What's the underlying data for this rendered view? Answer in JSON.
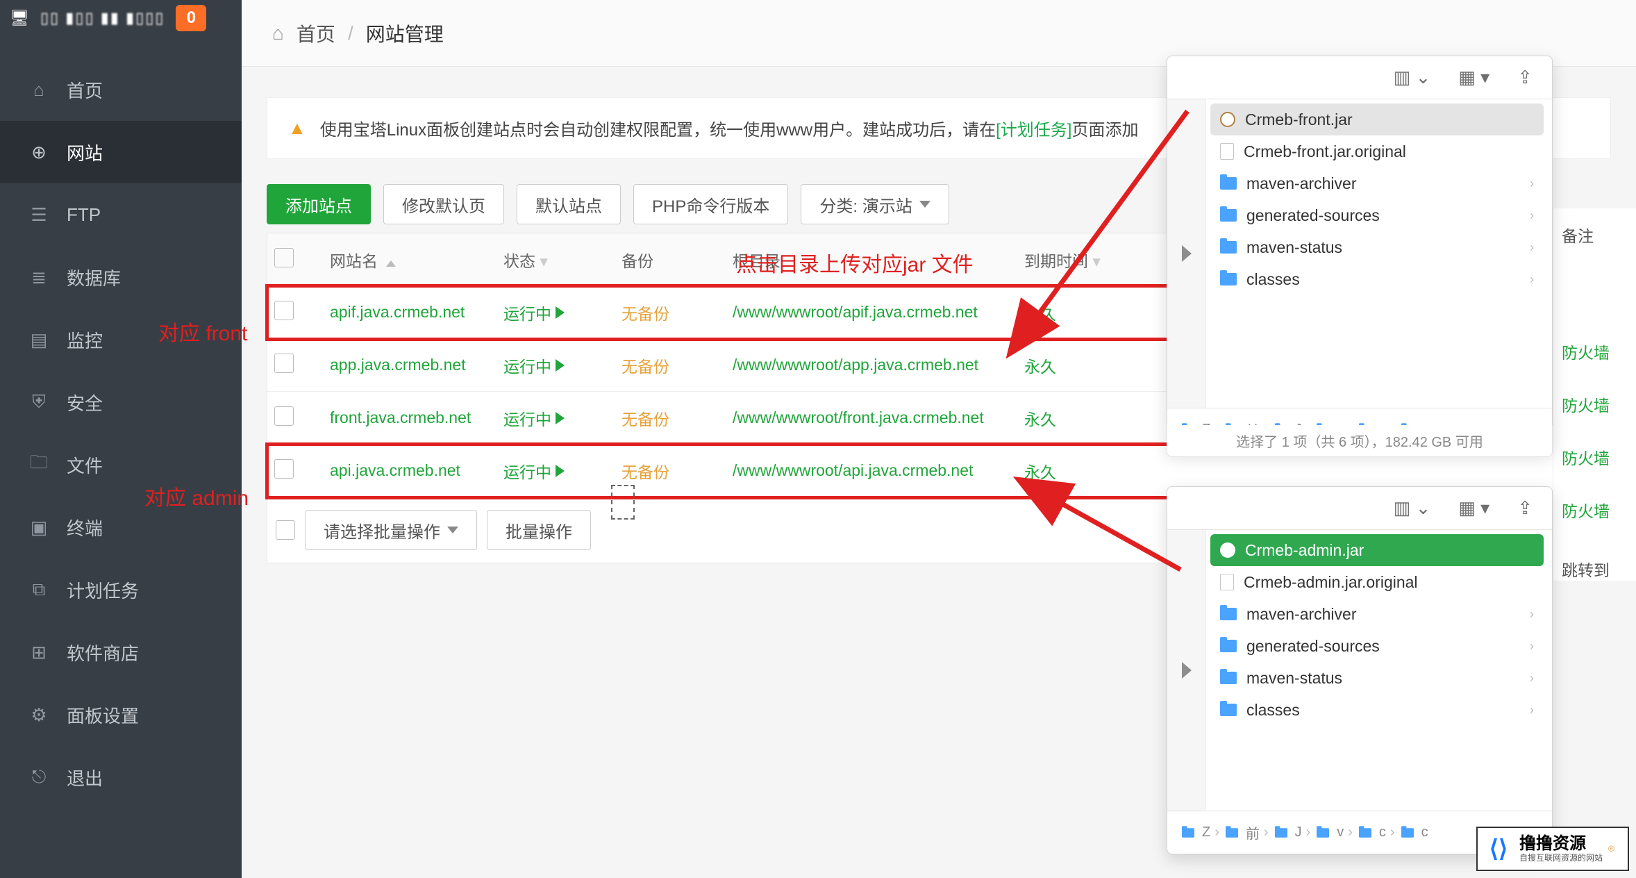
{
  "sidebar": {
    "badge": "0",
    "masked": "▯▯ ▮▯▯ ▮▮ ▮▯▯▯",
    "items": [
      {
        "label": "首页",
        "icon": "home"
      },
      {
        "label": "网站",
        "icon": "globe"
      },
      {
        "label": "FTP",
        "icon": "ftp"
      },
      {
        "label": "数据库",
        "icon": "database"
      },
      {
        "label": "监控",
        "icon": "monitor"
      },
      {
        "label": "安全",
        "icon": "shield"
      },
      {
        "label": "文件",
        "icon": "folder"
      },
      {
        "label": "终端",
        "icon": "terminal"
      },
      {
        "label": "计划任务",
        "icon": "schedule"
      },
      {
        "label": "软件商店",
        "icon": "apps"
      },
      {
        "label": "面板设置",
        "icon": "settings"
      },
      {
        "label": "退出",
        "icon": "logout"
      }
    ],
    "active_index": 1
  },
  "breadcrumb": {
    "home": "首页",
    "current": "网站管理"
  },
  "notice": {
    "pre": "使用宝塔Linux面板创建站点时会自动创建权限配置，统一使用www用户。建站成功后，请在",
    "link": "[计划任务]",
    "post": "页面添加"
  },
  "toolbar": {
    "add": "添加站点",
    "default": "修改默认页",
    "default_site": "默认站点",
    "php_cli": "PHP命令行版本",
    "category": "分类: 演示站"
  },
  "table": {
    "headers": {
      "name": "网站名",
      "status": "状态",
      "backup": "备份",
      "root": "根目录",
      "expire": "到期时间"
    },
    "rows": [
      {
        "site": "apif.java.crmeb.net",
        "status": "运行中",
        "backup": "无备份",
        "root": "/www/wwwroot/apif.java.crmeb.net",
        "expire": "永久"
      },
      {
        "site": "app.java.crmeb.net",
        "status": "运行中",
        "backup": "无备份",
        "root": "/www/wwwroot/app.java.crmeb.net",
        "expire": "永久"
      },
      {
        "site": "front.java.crmeb.net",
        "status": "运行中",
        "backup": "无备份",
        "root": "/www/wwwroot/front.java.crmeb.net",
        "expire": "永久"
      },
      {
        "site": "api.java.crmeb.net",
        "status": "运行中",
        "backup": "无备份",
        "root": "/www/wwwroot/api.java.crmeb.net",
        "expire": "永久"
      }
    ]
  },
  "batch": {
    "placeholder": "请选择批量操作",
    "action": "批量操作"
  },
  "annotations": {
    "upload_hint": "点击目录上传对应jar 文件",
    "front_label": "对应 front",
    "admin_label": "对应 admin"
  },
  "right_cut": {
    "header": "备注",
    "firewall": "防火墙",
    "jump": "跳转到"
  },
  "finder_front": {
    "items": [
      {
        "name": "Crmeb-front.jar",
        "type": "jar",
        "selected": "gray"
      },
      {
        "name": "Crmeb-front.jar.original",
        "type": "file"
      },
      {
        "name": "maven-archiver",
        "type": "folder"
      },
      {
        "name": "generated-sources",
        "type": "folder"
      },
      {
        "name": "maven-status",
        "type": "folder"
      },
      {
        "name": "classes",
        "type": "folder"
      }
    ],
    "path_segments": [
      "Z",
      "前",
      "J",
      "v",
      "c",
      "c"
    ],
    "status": "选择了 1 项（共 6 项），182.42 GB 可用"
  },
  "finder_admin": {
    "items": [
      {
        "name": "Crmeb-admin.jar",
        "type": "jar",
        "selected": "green"
      },
      {
        "name": "Crmeb-admin.jar.original",
        "type": "file"
      },
      {
        "name": "maven-archiver",
        "type": "folder"
      },
      {
        "name": "generated-sources",
        "type": "folder"
      },
      {
        "name": "maven-status",
        "type": "folder"
      },
      {
        "name": "classes",
        "type": "folder"
      }
    ],
    "path_segments": [
      "Z",
      "前",
      "J",
      "v",
      "c",
      "c"
    ]
  },
  "logo": {
    "title": "撸撸资源",
    "sub": "自搜互联网资源的网站"
  }
}
